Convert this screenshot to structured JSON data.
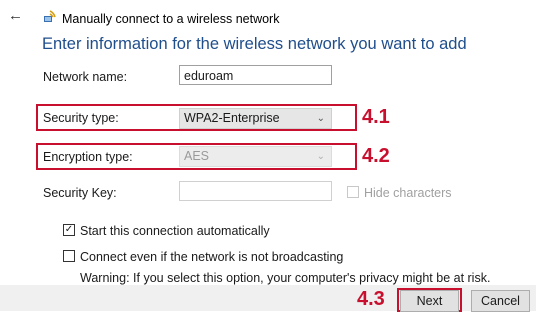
{
  "window": {
    "title": "Manually connect to a wireless network",
    "back_icon": "back-arrow-icon",
    "network_icon": "wireless-network-icon"
  },
  "heading": "Enter information for the wireless network you want to add",
  "form": {
    "network_name_label": "Network name:",
    "network_name_value": "eduroam",
    "security_type_label": "Security type:",
    "security_type_value": "WPA2-Enterprise",
    "encryption_type_label": "Encryption type:",
    "encryption_type_value": "AES",
    "security_key_label": "Security Key:",
    "security_key_value": "",
    "hide_characters_label": "Hide characters",
    "hide_characters_checked": false,
    "start_auto_label": "Start this connection automatically",
    "start_auto_checked": true,
    "connect_hidden_label": "Connect even if the network is not broadcasting",
    "connect_hidden_checked": false,
    "warning_text": "Warning: If you select this option, your computer's privacy might be at risk."
  },
  "annotations": {
    "step_1": "4.1",
    "step_2": "4.2",
    "step_3": "4.3",
    "highlight_color": "#c8102e"
  },
  "footer": {
    "next_label": "Next",
    "cancel_label": "Cancel"
  },
  "colors": {
    "heading": "#1f4e8c"
  }
}
